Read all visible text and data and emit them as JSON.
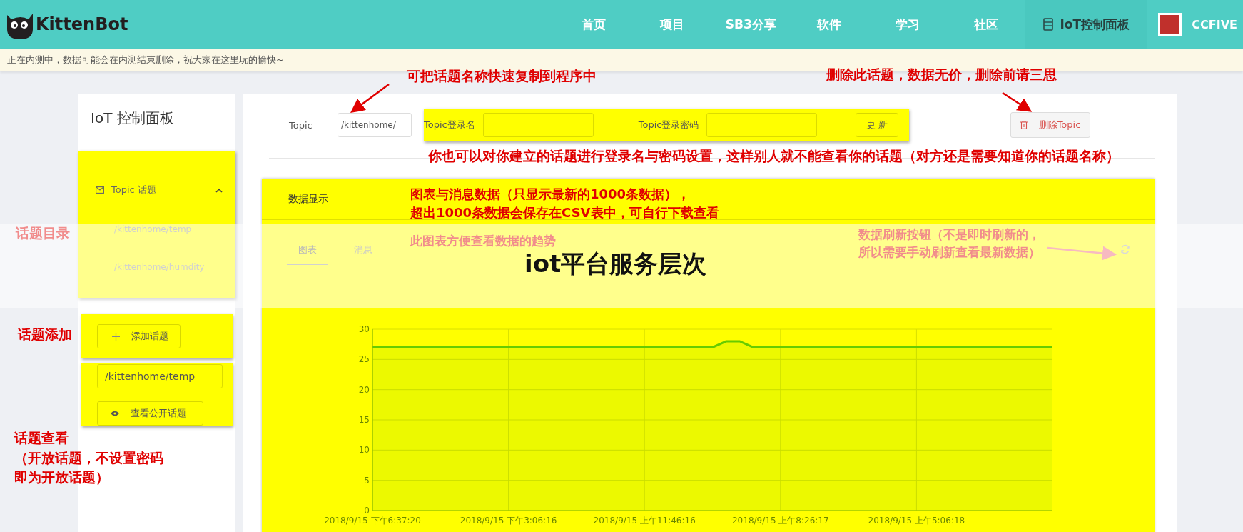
{
  "header": {
    "logo_text": "KittenBot",
    "nav": [
      {
        "label": "首页",
        "selected": false
      },
      {
        "label": "项目",
        "selected": false
      },
      {
        "label": "SB3分享",
        "selected": false
      },
      {
        "label": "软件",
        "selected": false
      },
      {
        "label": "学习",
        "selected": false
      },
      {
        "label": "社区",
        "selected": false
      },
      {
        "label": "IoT控制面板",
        "selected": true
      }
    ],
    "user": "CCFIVE"
  },
  "notice": "正在内测中，数据可能会在内测结束删除，祝大家在这里玩的愉快~",
  "sidebar": {
    "title": "IoT 控制面板",
    "topic_menu": {
      "label": "Topic 话题",
      "expanded": true,
      "children": [
        {
          "label": "/kittenhome/temp"
        },
        {
          "label": "/kittenhome/humdity"
        }
      ]
    },
    "add_button": "添加话题",
    "public_topic_value": "/kittenhome/temp",
    "view_button": "查看公开话题"
  },
  "topic_bar": {
    "label": "Topic",
    "value": "/kittenhome/",
    "login_label": "Topic登录名",
    "password_label": "Topic登录密码",
    "update_button": "更 新",
    "delete_button": "删除Topic"
  },
  "data_panel": {
    "title": "数据显示",
    "tabs": [
      {
        "label": "图表",
        "selected": true
      },
      {
        "label": "消息",
        "selected": false
      }
    ],
    "chart_data": {
      "type": "area",
      "categories": [
        "2018/9/15 下午6:37:20",
        null,
        null,
        null,
        null,
        null,
        null,
        null,
        null,
        null,
        "2018/9/15 下午3:06:16",
        null,
        null,
        null,
        null,
        null,
        null,
        null,
        null,
        null,
        "2018/9/15 上午11:46:16",
        null,
        null,
        null,
        null,
        null,
        null,
        null,
        null,
        null,
        "2018/9/15 上午8:26:17",
        null,
        null,
        null,
        null,
        null,
        null,
        null,
        null,
        null,
        "2018/9/15 上午5:06:18",
        null,
        null,
        null,
        null,
        null,
        null,
        null,
        null,
        null,
        null
      ],
      "series": [
        {
          "color": "#66cc00",
          "values": [
            27,
            27,
            27,
            27,
            27,
            27,
            27,
            27,
            27,
            27,
            27,
            27,
            27,
            27,
            27,
            27,
            27,
            27,
            27,
            27,
            27,
            27,
            27,
            27,
            27,
            27,
            28,
            28,
            27,
            27,
            27,
            27,
            27,
            27,
            27,
            27,
            27,
            27,
            27,
            27,
            27,
            27,
            27,
            27,
            27,
            27,
            27,
            27,
            27,
            27,
            27
          ]
        }
      ],
      "ylim": [
        0,
        30
      ],
      "grid": true,
      "yticks": [
        0,
        5,
        10,
        15,
        20,
        25,
        30
      ]
    }
  },
  "overlay_title": "iot平台服务层次",
  "annotations": [
    {
      "lines": [
        "可把话题名称快速复制到程序中"
      ]
    },
    {
      "lines": [
        "删除此话题，数据无价，删除前请三思"
      ]
    },
    {
      "lines": [
        "你也可以对你建立的话题进行登录名与密码设置，这样别人就不能查看你的话题（对方还是需要知道你的话题名称）"
      ]
    },
    {
      "lines": [
        "图表与消息数据（只显示最新的1000条数据），",
        "超出1000条数据会保存在CSV表中，可自行下载查看"
      ]
    },
    {
      "lines": [
        "话题目录"
      ]
    },
    {
      "lines": [
        "此图表方便查看数据的趋势"
      ]
    },
    {
      "lines": [
        "数据刷新按钮（不是即时刷新的，",
        "所以需要手动刷新查看最新数据）"
      ]
    },
    {
      "lines": [
        "话题添加"
      ]
    },
    {
      "lines": [
        "话题查看",
        "（开放话题，不设置密码",
        "即为开放话题）"
      ]
    }
  ]
}
